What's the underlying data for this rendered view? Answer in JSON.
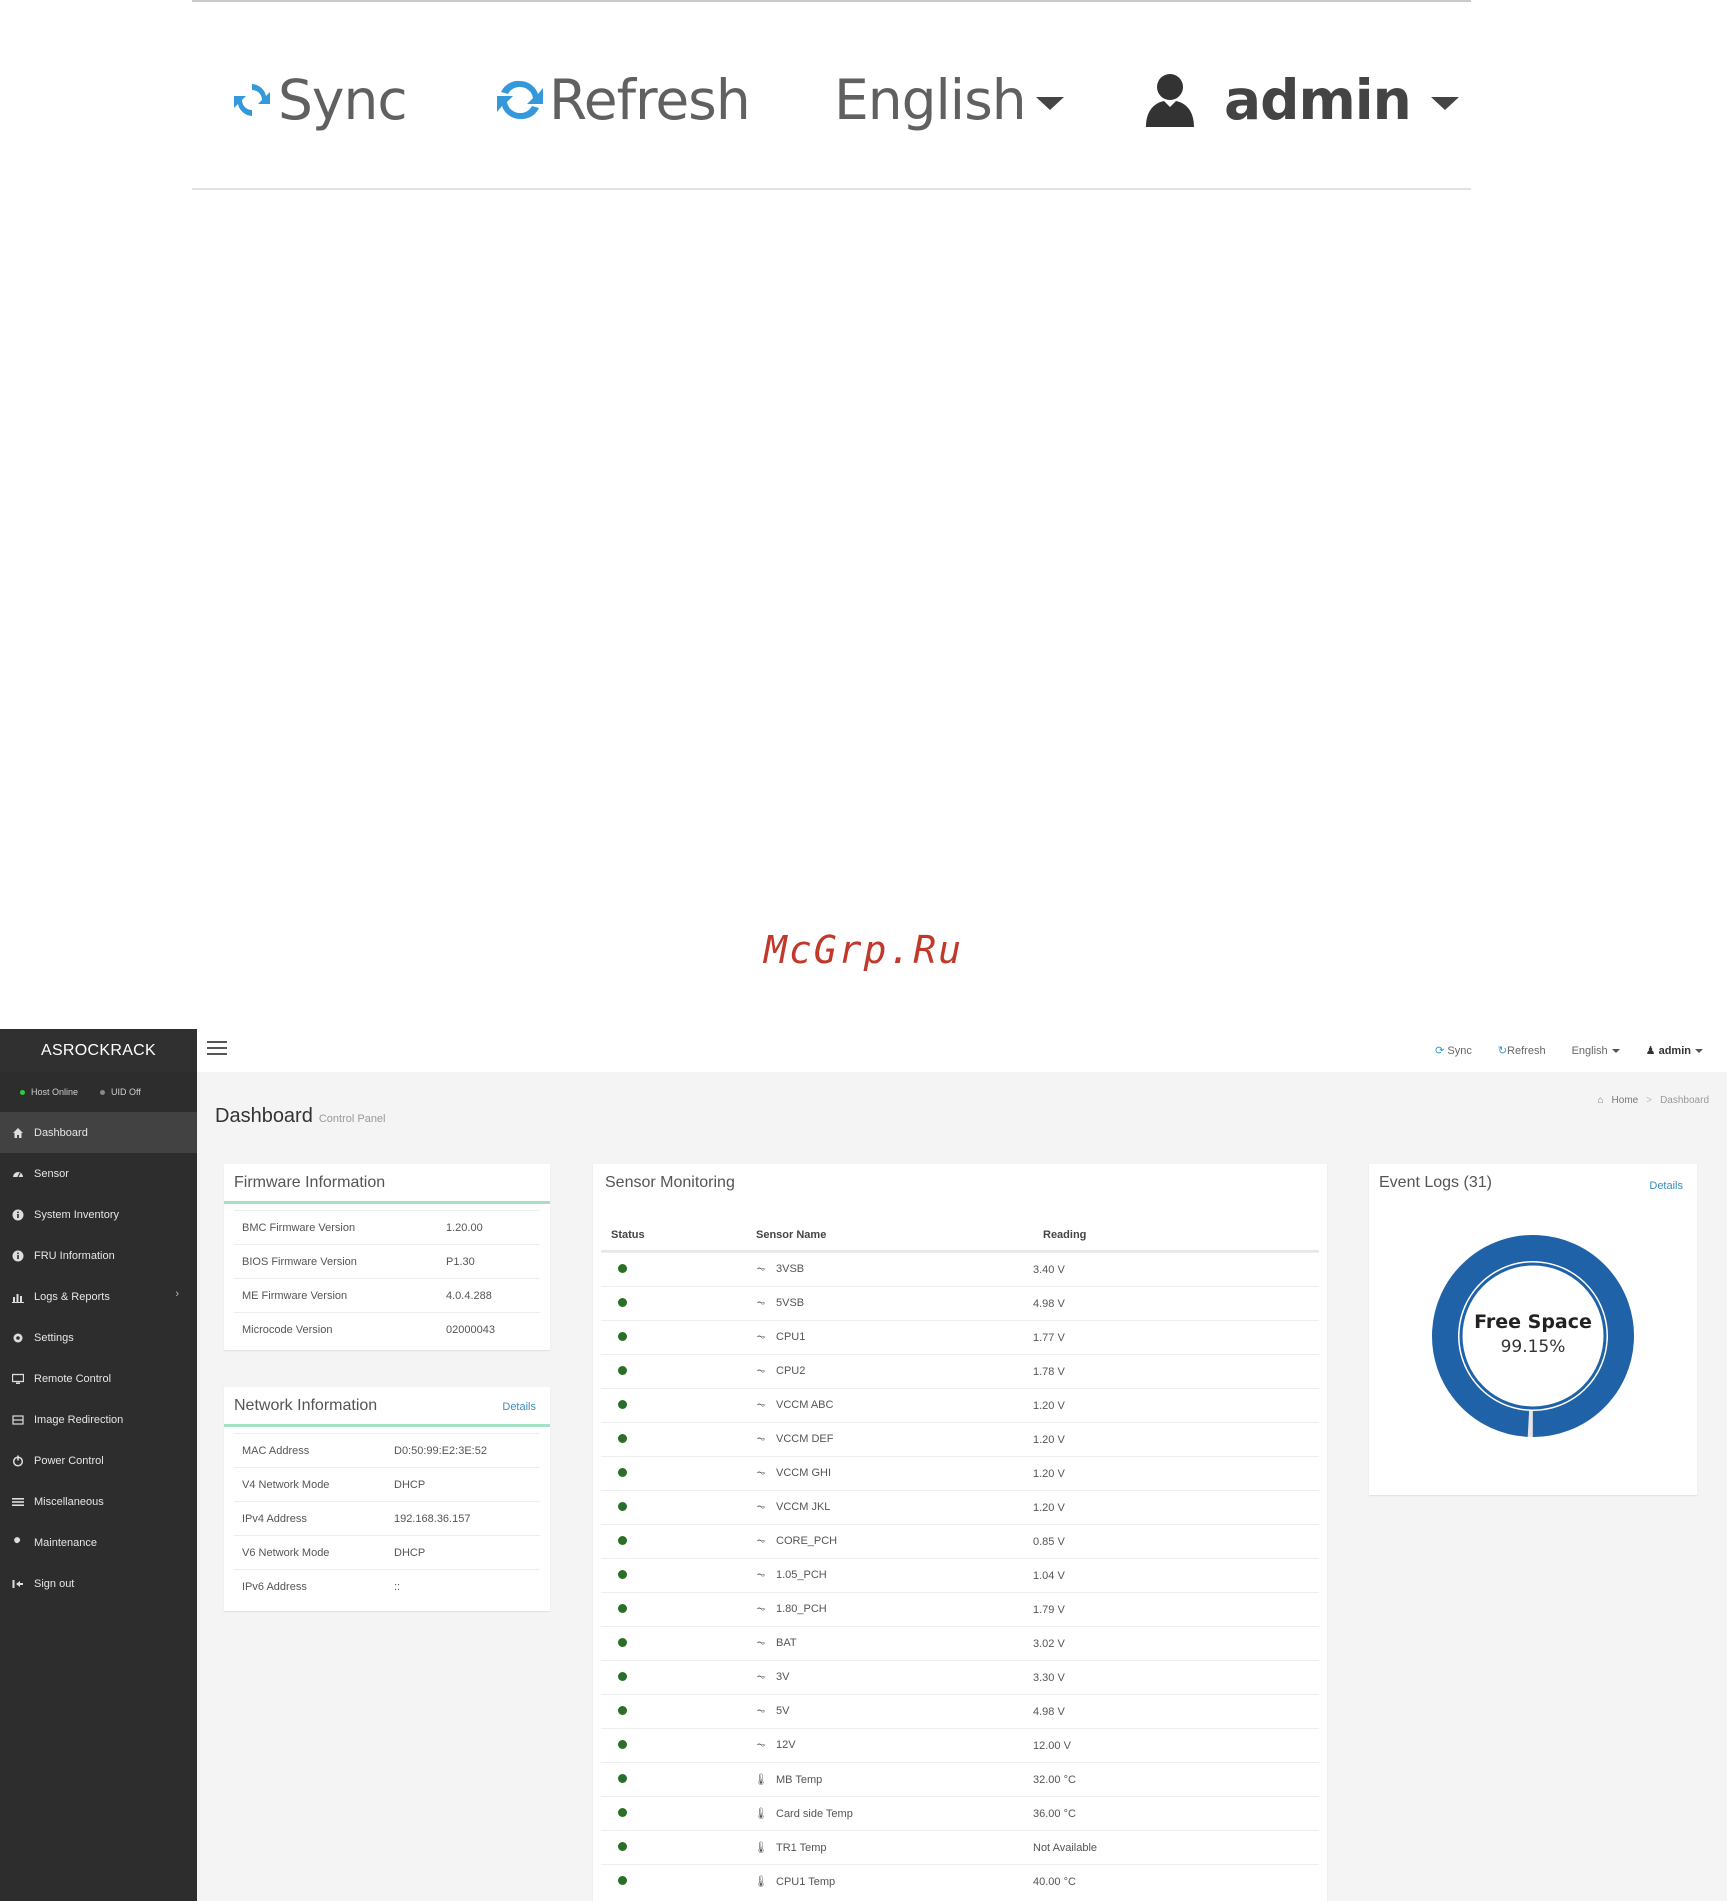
{
  "zoom": {
    "sync": "Sync",
    "refresh": "Refresh",
    "language": "English",
    "user": "admin"
  },
  "watermark": "McGrp.Ru",
  "brand": "ASROCKRACK",
  "host_status": {
    "host": "Host Online",
    "uid": "UID Off"
  },
  "nav": [
    {
      "label": "Dashboard",
      "icon": "home-icon"
    },
    {
      "label": "Sensor",
      "icon": "dashboard-gauge-icon"
    },
    {
      "label": "System Inventory",
      "icon": "info-circle-icon"
    },
    {
      "label": "FRU Information",
      "icon": "info-circle-icon"
    },
    {
      "label": "Logs & Reports",
      "icon": "bar-chart-icon"
    },
    {
      "label": "Settings",
      "icon": "gear-icon"
    },
    {
      "label": "Remote Control",
      "icon": "monitor-icon"
    },
    {
      "label": "Image Redirection",
      "icon": "disk-icon"
    },
    {
      "label": "Power Control",
      "icon": "power-icon"
    },
    {
      "label": "Miscellaneous",
      "icon": "list-icon"
    },
    {
      "label": "Maintenance",
      "icon": "wrench-icon"
    },
    {
      "label": "Sign out",
      "icon": "sign-out-icon"
    }
  ],
  "topbar": {
    "sync": "Sync",
    "refresh": "Refresh",
    "language": "English",
    "user": "admin"
  },
  "page": {
    "title": "Dashboard",
    "subtitle": "Control Panel"
  },
  "breadcrumb": {
    "home": "Home",
    "current": "Dashboard"
  },
  "firmware": {
    "title": "Firmware Information",
    "rows": [
      {
        "k": "BMC Firmware Version",
        "v": "1.20.00"
      },
      {
        "k": "BIOS Firmware Version",
        "v": "P1.30"
      },
      {
        "k": "ME Firmware Version",
        "v": "4.0.4.288"
      },
      {
        "k": "Microcode Version",
        "v": "02000043"
      }
    ]
  },
  "network": {
    "title": "Network Information",
    "details": "Details",
    "rows": [
      {
        "k": "MAC Address",
        "v": "D0:50:99:E2:3E:52"
      },
      {
        "k": "V4 Network Mode",
        "v": "DHCP"
      },
      {
        "k": "IPv4 Address",
        "v": "192.168.36.157"
      },
      {
        "k": "V6 Network Mode",
        "v": "DHCP"
      },
      {
        "k": "IPv6 Address",
        "v": "::"
      }
    ]
  },
  "sensors": {
    "title": "Sensor Monitoring",
    "headers": [
      "Status",
      "Sensor Name",
      "Reading"
    ],
    "rows": [
      {
        "name": "3VSB",
        "reading": "3.40 V",
        "kind": "voltage"
      },
      {
        "name": "5VSB",
        "reading": "4.98 V",
        "kind": "voltage"
      },
      {
        "name": "CPU1",
        "reading": "1.77 V",
        "kind": "voltage"
      },
      {
        "name": "CPU2",
        "reading": "1.78 V",
        "kind": "voltage"
      },
      {
        "name": "VCCM ABC",
        "reading": "1.20 V",
        "kind": "voltage"
      },
      {
        "name": "VCCM DEF",
        "reading": "1.20 V",
        "kind": "voltage"
      },
      {
        "name": "VCCM GHI",
        "reading": "1.20 V",
        "kind": "voltage"
      },
      {
        "name": "VCCM JKL",
        "reading": "1.20 V",
        "kind": "voltage"
      },
      {
        "name": "CORE_PCH",
        "reading": "0.85 V",
        "kind": "voltage"
      },
      {
        "name": "1.05_PCH",
        "reading": "1.04 V",
        "kind": "voltage"
      },
      {
        "name": "1.80_PCH",
        "reading": "1.79 V",
        "kind": "voltage"
      },
      {
        "name": "BAT",
        "reading": "3.02 V",
        "kind": "voltage"
      },
      {
        "name": "3V",
        "reading": "3.30 V",
        "kind": "voltage"
      },
      {
        "name": "5V",
        "reading": "4.98 V",
        "kind": "voltage"
      },
      {
        "name": "12V",
        "reading": "12.00 V",
        "kind": "voltage"
      },
      {
        "name": "MB Temp",
        "reading": "32.00 °C",
        "kind": "temp"
      },
      {
        "name": "Card side Temp",
        "reading": "36.00 °C",
        "kind": "temp"
      },
      {
        "name": "TR1 Temp",
        "reading": "Not Available",
        "kind": "temp"
      },
      {
        "name": "CPU1 Temp",
        "reading": "40.00 °C",
        "kind": "temp"
      }
    ]
  },
  "event_logs": {
    "title": "Event Logs (31)",
    "details": "Details",
    "free_label": "Free Space",
    "free_value": "99.15%",
    "free_fraction": 0.9915,
    "ring_color": "#1f62a8"
  }
}
